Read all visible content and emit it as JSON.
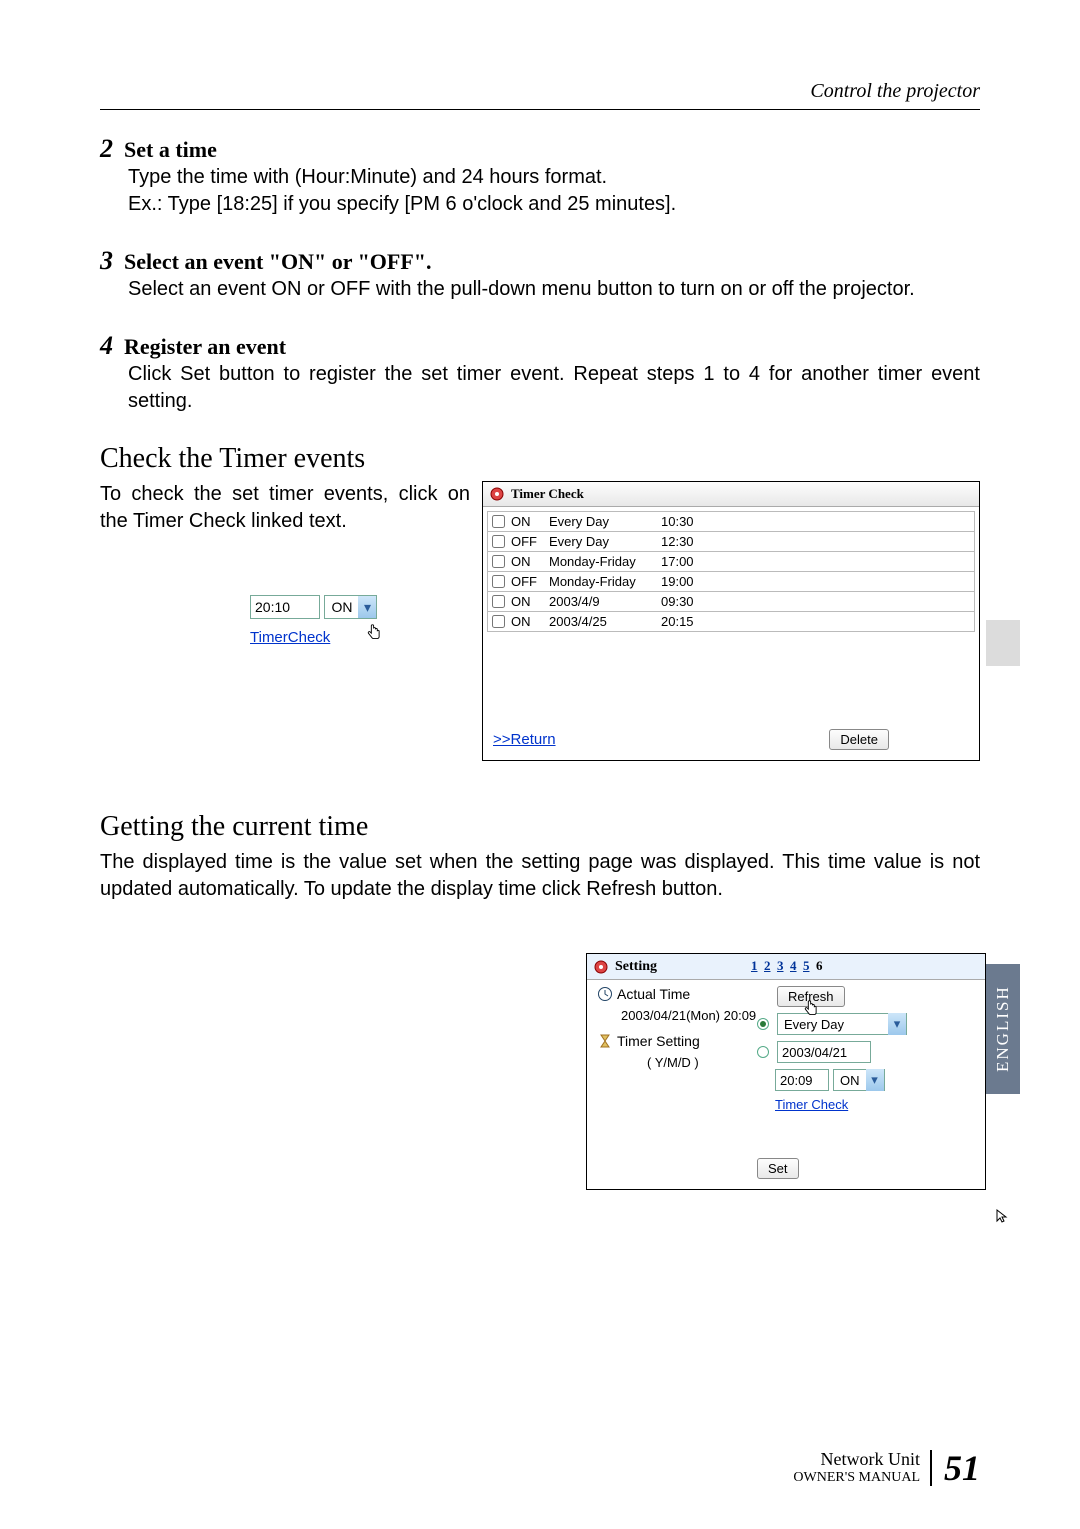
{
  "header": {
    "section": "Control the projector"
  },
  "steps": [
    {
      "num": "2",
      "title": "Set a time",
      "body": "Type the time with (Hour:Minute) and 24 hours format.\nEx.: Type [18:25] if you specify [PM 6 o'clock and 25 minutes]."
    },
    {
      "num": "3",
      "title": "Select an event \"ON\" or \"OFF\".",
      "body": "Select an event ON or OFF with the pull-down menu button to turn on or off the projector."
    },
    {
      "num": "4",
      "title": "Register an event",
      "body": "Click Set button to register the set timer event. Repeat steps 1 to 4 for another timer event setting."
    }
  ],
  "check": {
    "heading": "Check the Timer events",
    "intro": "To check the set timer events, click on the Timer Check linked text.",
    "small_time": "20:10",
    "small_state": "ON",
    "small_link": "TimerCheck"
  },
  "timer_check_panel": {
    "title": "Timer Check",
    "rows": [
      {
        "state": "ON",
        "sched": "Every Day",
        "time": "10:30"
      },
      {
        "state": "OFF",
        "sched": "Every Day",
        "time": "12:30"
      },
      {
        "state": "ON",
        "sched": "Monday-Friday",
        "time": "17:00"
      },
      {
        "state": "OFF",
        "sched": "Monday-Friday",
        "time": "19:00"
      },
      {
        "state": "ON",
        "sched": "2003/4/9",
        "time": "09:30"
      },
      {
        "state": "ON",
        "sched": "2003/4/25",
        "time": "20:15"
      }
    ],
    "return_label": ">>Return",
    "delete_label": "Delete"
  },
  "current_time": {
    "heading": "Getting the current time",
    "body": "The displayed time is the value set when the setting page was displayed. This time value is not updated automatically. To update the display time click Refresh button."
  },
  "setting_panel": {
    "title": "Setting",
    "pages": [
      "1",
      "2",
      "3",
      "4",
      "5",
      "6"
    ],
    "current_page": "6",
    "actual_time_label": "Actual Time",
    "actual_time_value": "2003/04/21(Mon) 20:09",
    "timer_setting_label": "Timer Setting",
    "ymd_label": "( Y/M/D )",
    "refresh_label": "Refresh",
    "every_day": "Every Day",
    "date_value": "2003/04/21",
    "time_value": "20:09",
    "state_value": "ON",
    "timer_check_link": "Timer Check",
    "set_label": "Set"
  },
  "side_tab": "ENGLISH",
  "footer": {
    "line1": "Network Unit",
    "line2": "OWNER'S MANUAL",
    "page": "51"
  }
}
